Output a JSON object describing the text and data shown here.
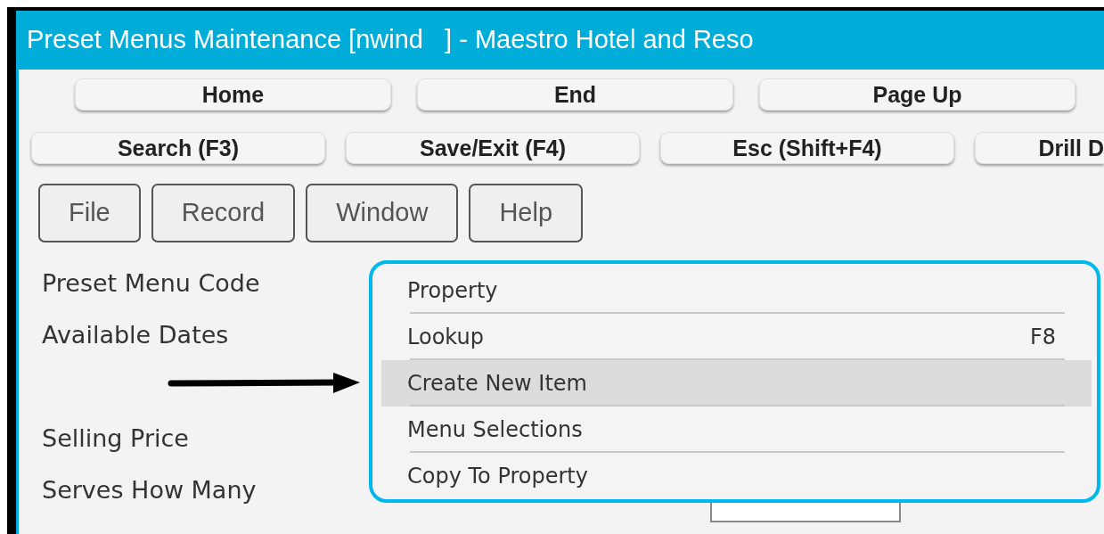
{
  "window": {
    "title": "Preset Menus Maintenance [nwind   ] - Maestro Hotel and Reso"
  },
  "nav_buttons": [
    "Home",
    "End",
    "Page Up"
  ],
  "action_buttons": [
    "Search (F3)",
    "Save/Exit (F4)",
    "Esc (Shift+F4)",
    "Drill D"
  ],
  "menu_bar": [
    "File",
    "Record",
    "Window",
    "Help"
  ],
  "form_labels": [
    "Preset Menu Code",
    "Available Dates",
    "Selling Price",
    "Serves How Many"
  ],
  "dropdown_menu": {
    "items": [
      {
        "label": "Property",
        "selected": false
      },
      {
        "label": "Lookup",
        "shortcut": "F8",
        "selected": false
      },
      {
        "label": "Create New Item",
        "selected": true
      },
      {
        "label": "Menu Selections",
        "selected": false
      },
      {
        "label": "Copy To Property",
        "selected": false
      }
    ]
  }
}
